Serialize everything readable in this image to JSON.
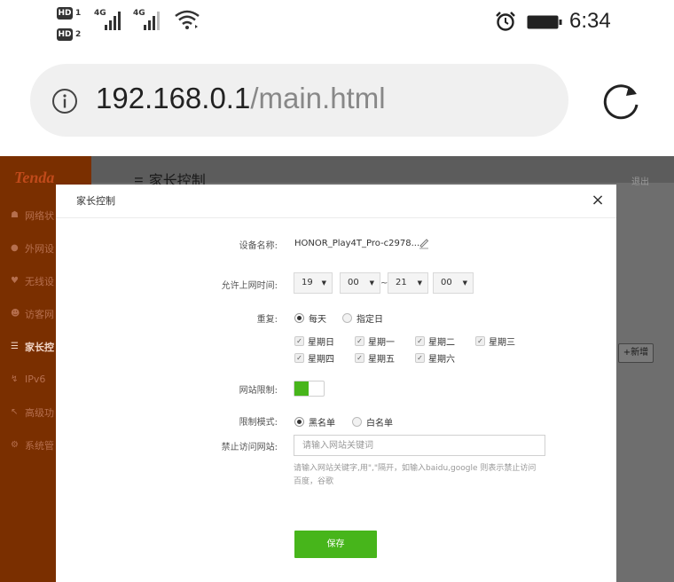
{
  "statusbar": {
    "hd1": "HD",
    "hd1_sub": "1",
    "hd2": "HD",
    "hd2_sub": "2",
    "sim1_tech": "4G",
    "sim2_tech": "4G",
    "time": "6:34",
    "icons": [
      "signal-icon",
      "wifi-icon",
      "alarm-icon",
      "battery-icon"
    ]
  },
  "browser": {
    "url_host": "192.168.0.1",
    "url_path": "/main.html",
    "info_icon": "info-icon",
    "reload_icon": "reload-icon"
  },
  "router": {
    "logo": "Tenda",
    "page_title": "家长控制",
    "exit": "退出",
    "add_button": "+新增",
    "menu": [
      {
        "icon": "网",
        "label": "网络状态"
      },
      {
        "icon": "外",
        "label": "外网设置"
      },
      {
        "icon": "无",
        "label": "无线设置"
      },
      {
        "icon": "访",
        "label": "访客网络"
      },
      {
        "icon": "家",
        "label": "家长控制"
      },
      {
        "icon": "I",
        "label": "IPv6"
      },
      {
        "icon": "高",
        "label": "高级功能"
      },
      {
        "icon": "系",
        "label": "系统管理"
      }
    ],
    "menu_texts": [
      "网络状",
      "外网设",
      "无线设",
      "访客网",
      "家长控",
      "IPv6",
      "高级功",
      "系统管"
    ]
  },
  "modal": {
    "title": "家长控制",
    "close": "×",
    "device_name_label": "设备名称:",
    "device_name_value": "HONOR_Play4T_Pro-c2978...",
    "online_time_label": "允许上网时间:",
    "time": {
      "start_hour": "19",
      "start_minute": "00",
      "separator": "~",
      "end_hour": "21",
      "end_minute": "00"
    },
    "repeat_label": "重复:",
    "repeat_options": [
      "每天",
      "指定日"
    ],
    "repeat_selected": "每天",
    "days": [
      "星期日",
      "星期一",
      "星期二",
      "星期三",
      "星期四",
      "星期五",
      "星期六"
    ],
    "website_limit_label": "网站限制:",
    "website_limit_on": true,
    "limit_mode_label": "限制模式:",
    "limit_mode_options": [
      "黑名单",
      "白名单"
    ],
    "limit_mode_selected": "黑名单",
    "blocked_sites_label": "禁止访问网站:",
    "blocked_sites_placeholder": "请输入网站关键词",
    "hint": "请输入网站关键字,用\",\"隔开，如输入baidu,google 则表示禁止访问百度，谷歌",
    "save_button": "保存"
  },
  "colors": {
    "accent_green": "#47b51b",
    "sidebar_brown": "#7a2f00",
    "overlay_gray": "#6e6e6e"
  }
}
